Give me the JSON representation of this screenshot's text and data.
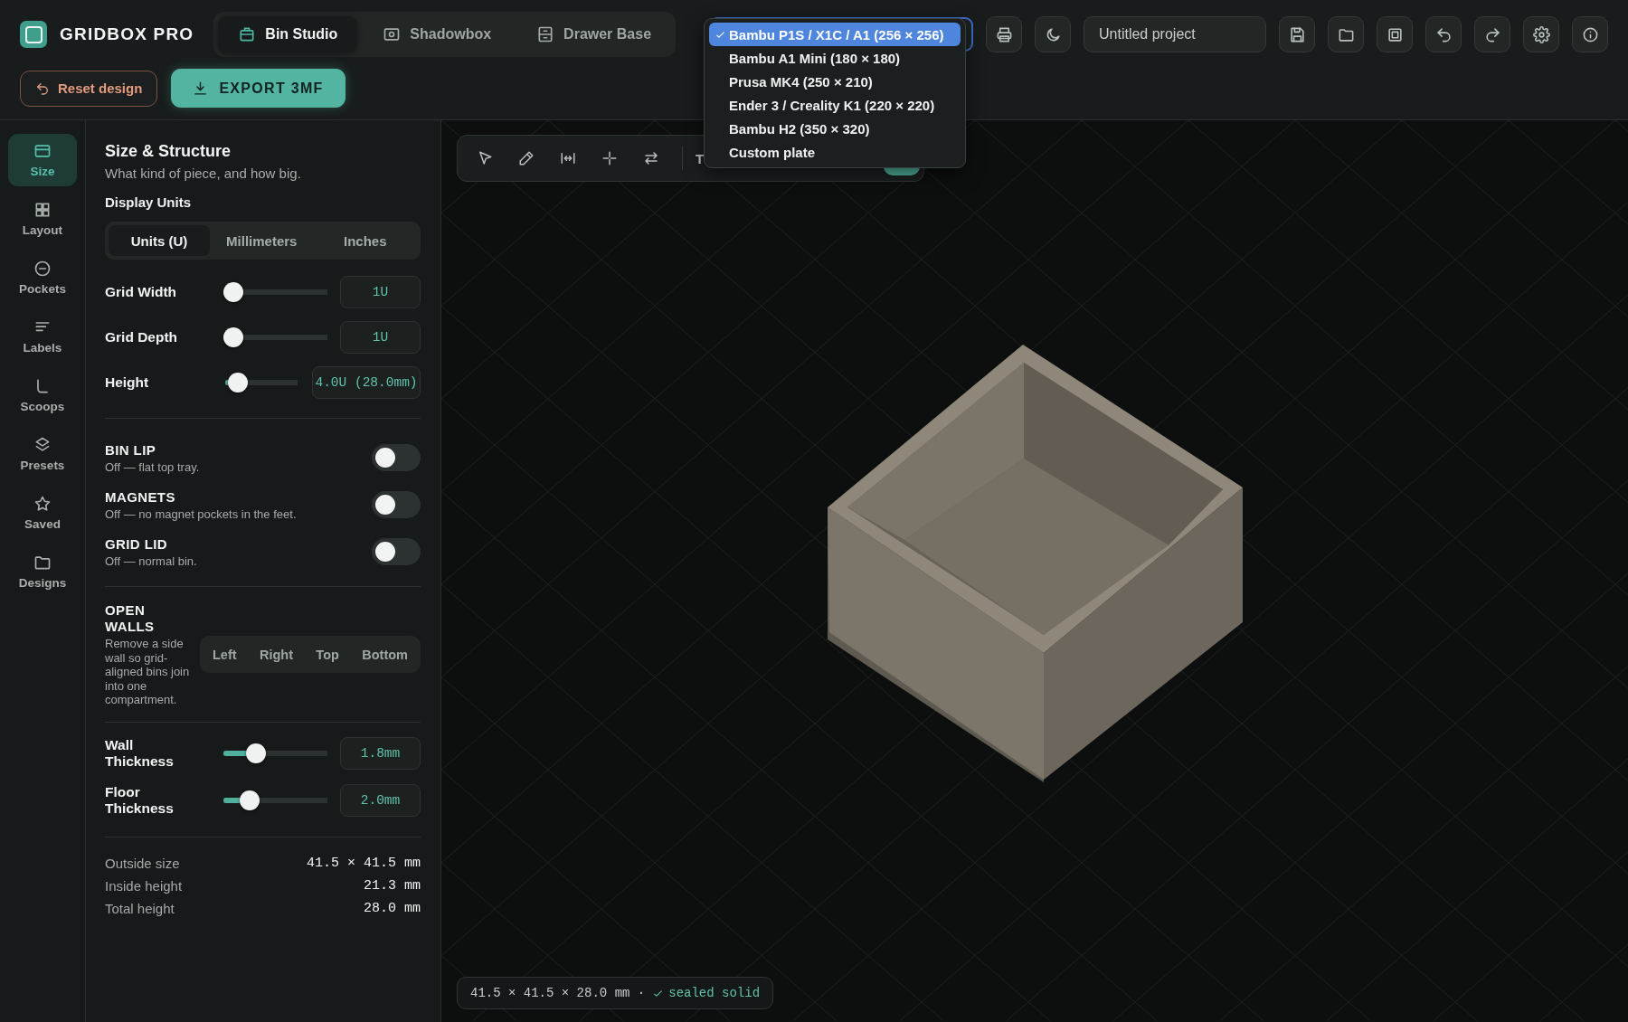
{
  "app": {
    "title": "GRIDBOX PRO"
  },
  "mode_tabs": [
    {
      "label": "Bin Studio",
      "selected": true
    },
    {
      "label": "Shadowbox",
      "selected": false
    },
    {
      "label": "Drawer Base",
      "selected": false
    }
  ],
  "actions": {
    "reset": "Reset design",
    "export": "EXPORT 3MF"
  },
  "printer_menu": [
    {
      "label": "Bambu P1S / X1C / A1 (256 × 256)",
      "selected": true
    },
    {
      "label": "Bambu A1 Mini (180 × 180)",
      "selected": false
    },
    {
      "label": "Prusa MK4 (250 × 210)",
      "selected": false
    },
    {
      "label": "Ender 3 / Creality K1 (220 × 220)",
      "selected": false
    },
    {
      "label": "Bambu H2 (350 × 320)",
      "selected": false
    },
    {
      "label": "Custom plate",
      "selected": false
    }
  ],
  "project_name": {
    "value": "Untitled project"
  },
  "rail": [
    {
      "label": "Size",
      "selected": true
    },
    {
      "label": "Layout",
      "selected": false
    },
    {
      "label": "Pockets",
      "selected": false
    },
    {
      "label": "Labels",
      "selected": false
    },
    {
      "label": "Scoops",
      "selected": false
    },
    {
      "label": "Presets",
      "selected": false
    },
    {
      "label": "Saved",
      "selected": false
    },
    {
      "label": "Designs",
      "selected": false
    }
  ],
  "panel": {
    "title": "Size & Structure",
    "subtitle": "What kind of piece, and how big.",
    "units_label": "Display Units",
    "units": [
      {
        "label": "Units (U)",
        "selected": true
      },
      {
        "label": "Millimeters",
        "selected": false
      },
      {
        "label": "Inches",
        "selected": false
      }
    ],
    "sliders": [
      {
        "label": "Grid Width",
        "level": 0,
        "value": "1U"
      },
      {
        "label": "Grid Depth",
        "level": 0,
        "value": "1U"
      },
      {
        "label": "Height",
        "level": 0.05,
        "value": "4.0U (28.0mm)"
      }
    ],
    "toggles": [
      {
        "label": "BIN LIP",
        "description": "Off — flat top tray.",
        "on": false
      },
      {
        "label": "MAGNETS",
        "description": "Off — no magnet pockets in the feet.",
        "on": false
      },
      {
        "label": "GRID LID",
        "description": "Off — normal bin.",
        "on": false
      }
    ],
    "open_walls": {
      "label": "OPEN WALLS",
      "description": "Remove a side wall so grid-aligned bins join into one compartment.",
      "options": [
        {
          "label": "Left",
          "selected": false
        },
        {
          "label": "Right",
          "selected": false
        },
        {
          "label": "Top",
          "selected": false
        },
        {
          "label": "Bottom",
          "selected": false
        }
      ]
    },
    "thickness": [
      {
        "label": "Wall Thickness",
        "level": 0.27,
        "value": "1.8mm"
      },
      {
        "label": "Floor Thickness",
        "level": 0.19,
        "value": "2.0mm"
      }
    ],
    "summary": [
      {
        "label": "Outside size",
        "value": "41.5 × 41.5 mm"
      },
      {
        "label": "Inside height",
        "value": "21.3 mm"
      },
      {
        "label": "Total height",
        "value": "28.0 mm"
      }
    ]
  },
  "viewport": {
    "toolbar_label": "T",
    "status": {
      "dimensions": "41.5 × 41.5 × 28.0 mm ·",
      "check": "sealed solid"
    }
  }
}
